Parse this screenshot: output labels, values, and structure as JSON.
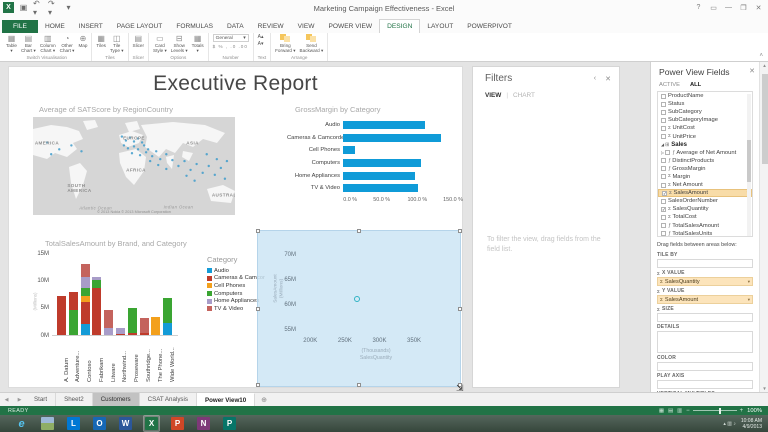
{
  "window": {
    "title": "Marketing Campaign Effectiveness - Excel",
    "quick_access": [
      {
        "name": "excel-logo-icon",
        "glyph": "X"
      },
      {
        "name": "save-icon",
        "glyph": "▣"
      },
      {
        "name": "undo-icon",
        "glyph": "↶ ▾"
      },
      {
        "name": "redo-icon",
        "glyph": "↷ ▾"
      },
      {
        "name": "qat-more-icon",
        "glyph": "▾"
      }
    ],
    "controls": [
      {
        "name": "help-icon",
        "glyph": "?"
      },
      {
        "name": "ribbon-display-icon",
        "glyph": "▭"
      },
      {
        "name": "minimize-icon",
        "glyph": "—"
      },
      {
        "name": "restore-icon",
        "glyph": "❐"
      },
      {
        "name": "close-icon",
        "glyph": "✕"
      }
    ]
  },
  "ribbon": {
    "tabs": [
      {
        "label": "FILE",
        "type": "file"
      },
      {
        "label": "HOME"
      },
      {
        "label": "INSERT"
      },
      {
        "label": "PAGE LAYOUT"
      },
      {
        "label": "FORMULAS"
      },
      {
        "label": "DATA"
      },
      {
        "label": "REVIEW"
      },
      {
        "label": "VIEW"
      },
      {
        "label": "POWER VIEW"
      },
      {
        "label": "DESIGN",
        "active": true
      },
      {
        "label": "LAYOUT"
      },
      {
        "label": "POWERPIVOT"
      }
    ],
    "groups": [
      {
        "label": "Switch Visualisation",
        "buttons": [
          {
            "label": "Table",
            "icon": "table-icon",
            "dd": true
          },
          {
            "label": "Bar Chart",
            "icon": "bar-chart-icon",
            "dd": true
          },
          {
            "label": "Column Chart",
            "icon": "column-chart-icon",
            "dd": true
          },
          {
            "label": "Other Chart",
            "icon": "other-chart-icon",
            "dd": true
          },
          {
            "label": "Map",
            "icon": "map-icon"
          }
        ]
      },
      {
        "label": "Tiles",
        "buttons": [
          {
            "label": "Tiles",
            "icon": "tiles-icon"
          },
          {
            "label": "Tile Type",
            "icon": "tile-type-icon",
            "dd": true
          }
        ]
      },
      {
        "label": "Slicer",
        "buttons": [
          {
            "label": "Slicer",
            "icon": "slicer-icon"
          }
        ]
      },
      {
        "label": "Options",
        "buttons": [
          {
            "label": "Card Style",
            "icon": "card-style-icon",
            "dd": true
          },
          {
            "label": "Show Levels",
            "icon": "show-levels-icon",
            "dd": true
          },
          {
            "label": "Totals",
            "icon": "totals-icon",
            "dd": true
          }
        ]
      },
      {
        "label": "Number",
        "type": "number",
        "dropdown": "General",
        "format_glyphs": "$ % , .0 .00"
      },
      {
        "label": "Text",
        "type": "text",
        "glyphs": [
          "A▴",
          "A▾"
        ]
      },
      {
        "label": "Arrange",
        "buttons": [
          {
            "label": "Bring Forward",
            "icon": "bring-forward-icon",
            "dd": true
          },
          {
            "label": "Send Backward",
            "icon": "send-backward-icon",
            "dd": true
          }
        ]
      }
    ]
  },
  "canvas": {
    "report_title": "Executive Report"
  },
  "chart_data": [
    {
      "type": "map",
      "title": "Average of SATScore by RegionCountry",
      "attribution": "© 2013 Nokia  © 2013 Microsoft Corporation",
      "region_labels": [
        {
          "text": "NORTH AMERICA",
          "x": 2,
          "y": 27,
          "cls": "land"
        },
        {
          "text": "EUROPE",
          "x": 50,
          "y": 21,
          "cls": "land"
        },
        {
          "text": "ASIA",
          "x": 79,
          "y": 27,
          "cls": "land"
        },
        {
          "text": "AFRICA",
          "x": 51,
          "y": 54,
          "cls": "land"
        },
        {
          "text": "SOUTH\nAMERICA",
          "x": 23,
          "y": 72,
          "cls": "land"
        },
        {
          "text": "AUSTRALIA",
          "x": 96,
          "y": 80,
          "cls": "land"
        },
        {
          "text": "Atlantic Ocean",
          "x": 31,
          "y": 93,
          "cls": "ocean"
        },
        {
          "text": "Indian Ocean",
          "x": 72,
          "y": 92,
          "cls": "ocean"
        }
      ],
      "dot_color": "#3f9ccb",
      "points": [
        [
          7,
          26
        ],
        [
          13,
          33
        ],
        [
          19,
          29
        ],
        [
          9,
          38
        ],
        [
          24,
          35
        ],
        [
          44,
          20
        ],
        [
          46,
          24
        ],
        [
          48,
          21
        ],
        [
          50,
          25
        ],
        [
          52,
          22
        ],
        [
          54,
          26
        ],
        [
          45,
          29
        ],
        [
          47,
          32
        ],
        [
          50,
          30
        ],
        [
          52,
          33
        ],
        [
          55,
          29
        ],
        [
          57,
          33
        ],
        [
          49,
          37
        ],
        [
          53,
          39
        ],
        [
          56,
          36
        ],
        [
          59,
          40
        ],
        [
          61,
          35
        ],
        [
          63,
          43
        ],
        [
          66,
          38
        ],
        [
          58,
          45
        ],
        [
          62,
          49
        ],
        [
          66,
          53
        ],
        [
          69,
          44
        ],
        [
          72,
          50
        ],
        [
          75,
          45
        ],
        [
          78,
          54
        ],
        [
          81,
          48
        ],
        [
          84,
          57
        ],
        [
          87,
          50
        ],
        [
          90,
          59
        ],
        [
          93,
          52
        ],
        [
          95,
          63
        ],
        [
          86,
          38
        ],
        [
          91,
          43
        ],
        [
          96,
          45
        ],
        [
          76,
          60
        ],
        [
          80,
          65
        ]
      ]
    },
    {
      "type": "bar",
      "title": "GrossMargin by Category",
      "categories": [
        "Audio",
        "Cameras & Camcorders",
        "Cell Phones",
        "Computers",
        "Home Appliances",
        "TV & Video"
      ],
      "values": [
        111,
        133,
        16,
        105,
        98,
        101
      ],
      "xtick_values": [
        0,
        50,
        100,
        150
      ],
      "xtick_labels": [
        "0.0 %",
        "50.0 %",
        "100.0 %",
        "150.0 %"
      ],
      "xlim": [
        0,
        157
      ],
      "bar_color": "#0f9bd8"
    },
    {
      "type": "stacked-column",
      "title": "TotalSalesAmount by Brand, and Category",
      "ylabel": "(Millions)",
      "legend_title": "Category",
      "ytick_values": [
        0,
        5,
        10,
        15
      ],
      "ytick_labels": [
        "0M",
        "5M",
        "10M",
        "15M"
      ],
      "ylim": [
        0,
        15
      ],
      "series": [
        {
          "name": "Audio",
          "color": "#149bd7"
        },
        {
          "name": "Cameras & Camcorders",
          "color": "#bf3b2b"
        },
        {
          "name": "Cell Phones",
          "color": "#f3a01c"
        },
        {
          "name": "Computers",
          "color": "#3aa532"
        },
        {
          "name": "Home Appliances",
          "color": "#a89cc8"
        },
        {
          "name": "TV & Video",
          "color": "#c4635d"
        }
      ],
      "categories": [
        "A. Datum",
        "Adventure...",
        "Contoso",
        "Fabrikam",
        "Litware",
        "Northwind...",
        "Proseware",
        "Southridge...",
        "The Phone...",
        "Wide World..."
      ],
      "stacks": [
        [
          [
            1,
            7.2
          ]
        ],
        [
          [
            3,
            4.5
          ],
          [
            1,
            3.3
          ]
        ],
        [
          [
            0,
            2.1
          ],
          [
            1,
            3.9
          ],
          [
            2,
            1.1
          ],
          [
            3,
            1.5
          ],
          [
            4,
            2.1
          ],
          [
            5,
            2.3
          ]
        ],
        [
          [
            1,
            8.6
          ],
          [
            3,
            1.4
          ],
          [
            4,
            0.6
          ]
        ],
        [
          [
            4,
            1.2
          ],
          [
            5,
            3.3
          ]
        ],
        [
          [
            1,
            0.2
          ],
          [
            4,
            1.1
          ]
        ],
        [
          [
            1,
            0.3
          ],
          [
            3,
            4.7
          ]
        ],
        [
          [
            1,
            0.4
          ],
          [
            5,
            2.7
          ]
        ],
        [
          [
            2,
            3.3
          ]
        ],
        [
          [
            0,
            2.2
          ],
          [
            3,
            4.6
          ]
        ]
      ]
    },
    {
      "type": "scatter",
      "ylabel_lines": [
        "SalesAmount",
        "(Millions)"
      ],
      "xlabel_lines": [
        "(Thousands)",
        "SalesQuantity"
      ],
      "xtick_values": [
        200,
        250,
        300,
        350
      ],
      "xtick_labels": [
        "200K",
        "250K",
        "300K",
        "350K"
      ],
      "ytick_values": [
        55,
        60,
        65,
        70
      ],
      "ytick_labels": [
        "55M",
        "60M",
        "65M",
        "70M"
      ],
      "xlim": [
        188,
        402
      ],
      "ylim": [
        54,
        72.5
      ],
      "points": [
        {
          "x": 268,
          "y": 61.4
        }
      ],
      "point_color": "#2fb3c4"
    }
  ],
  "filters": {
    "title": "Filters",
    "tabs": [
      "VIEW",
      "CHART"
    ],
    "active_tab": "VIEW",
    "hint": "To filter the view, drag fields from the field list.",
    "icons": [
      "chevron-left-icon",
      "close-icon"
    ]
  },
  "fields_panel": {
    "title": "Power View Fields",
    "tabs": [
      "ACTIVE",
      "ALL"
    ],
    "active_tab": "ALL",
    "fields": [
      {
        "label": "ProductName"
      },
      {
        "label": "Status"
      },
      {
        "label": "SubCategory"
      },
      {
        "label": "SubCategoryImage"
      },
      {
        "label": "UnitCost",
        "sigma": true
      },
      {
        "label": "UnitPrice",
        "sigma": true
      },
      {
        "label": "Sales",
        "table": true
      },
      {
        "label": "Average of Net Amount",
        "calc": true,
        "expand": true
      },
      {
        "label": "DistinctProducts",
        "calc": true
      },
      {
        "label": "GrossMargin",
        "calc": true
      },
      {
        "label": "Margin",
        "sigma": true
      },
      {
        "label": "Net Amount",
        "sigma": true
      },
      {
        "label": "SalesAmount",
        "sigma": true,
        "check": true,
        "selected": true
      },
      {
        "label": "SalesOrderNumber"
      },
      {
        "label": "SalesQuantity",
        "sigma": true,
        "check": true
      },
      {
        "label": "TotalCost",
        "sigma": true
      },
      {
        "label": "TotalSalesAmount",
        "calc": true
      },
      {
        "label": "TotalSalesUnits",
        "calc": true
      }
    ],
    "drag_hint": "Drag fields between areas below:",
    "wells": [
      {
        "label": "TILE BY",
        "pills": []
      },
      {
        "label": "X VALUE",
        "sigma": true,
        "pills": [
          {
            "label": "SalesQuantity"
          }
        ]
      },
      {
        "label": "Y VALUE",
        "sigma": true,
        "pills": [
          {
            "label": "SalesAmount"
          }
        ]
      },
      {
        "label": "SIZE",
        "sigma": true,
        "pills": []
      },
      {
        "label": "DETAILS",
        "tall": true,
        "pills": []
      },
      {
        "label": "COLOR",
        "pills": []
      },
      {
        "label": "PLAY AXIS",
        "pills": []
      },
      {
        "label": "VERTICAL MULTIPLES",
        "pills": []
      }
    ]
  },
  "sheet_tabs": {
    "nav": [
      "◀",
      "▶"
    ],
    "tabs": [
      {
        "label": "Start"
      },
      {
        "label": "Sheet2"
      },
      {
        "label": "Customers",
        "highlight": true
      },
      {
        "label": "CSAT Analysis"
      },
      {
        "label": "Power View10",
        "active": true
      }
    ],
    "add_glyph": "⊕"
  },
  "status_bar": {
    "mode": "READY",
    "zoom": "100%"
  },
  "taskbar": {
    "icons": [
      {
        "name": "ie-icon",
        "glyph": "e",
        "bg": "",
        "cls": "ie"
      },
      {
        "name": "photos-icon",
        "glyph": "",
        "bg": "",
        "cls": "photo"
      },
      {
        "name": "lync-icon",
        "glyph": "L",
        "bg": "#0078d4"
      },
      {
        "name": "outlook-icon",
        "glyph": "O",
        "bg": "#1668b5"
      },
      {
        "name": "word-icon",
        "glyph": "W",
        "bg": "#2b579a"
      },
      {
        "name": "excel-icon",
        "glyph": "X",
        "bg": "#217346",
        "active": true
      },
      {
        "name": "powerpoint-icon",
        "glyph": "P",
        "bg": "#d04727"
      },
      {
        "name": "onenote-icon",
        "glyph": "N",
        "bg": "#7e3878"
      },
      {
        "name": "publisher-icon",
        "glyph": "P",
        "bg": "#077568"
      }
    ],
    "tray_glyphs": [
      "▴",
      "▥",
      "♪"
    ],
    "clock": {
      "time": "10:08 AM",
      "date": "4/9/2013"
    }
  }
}
